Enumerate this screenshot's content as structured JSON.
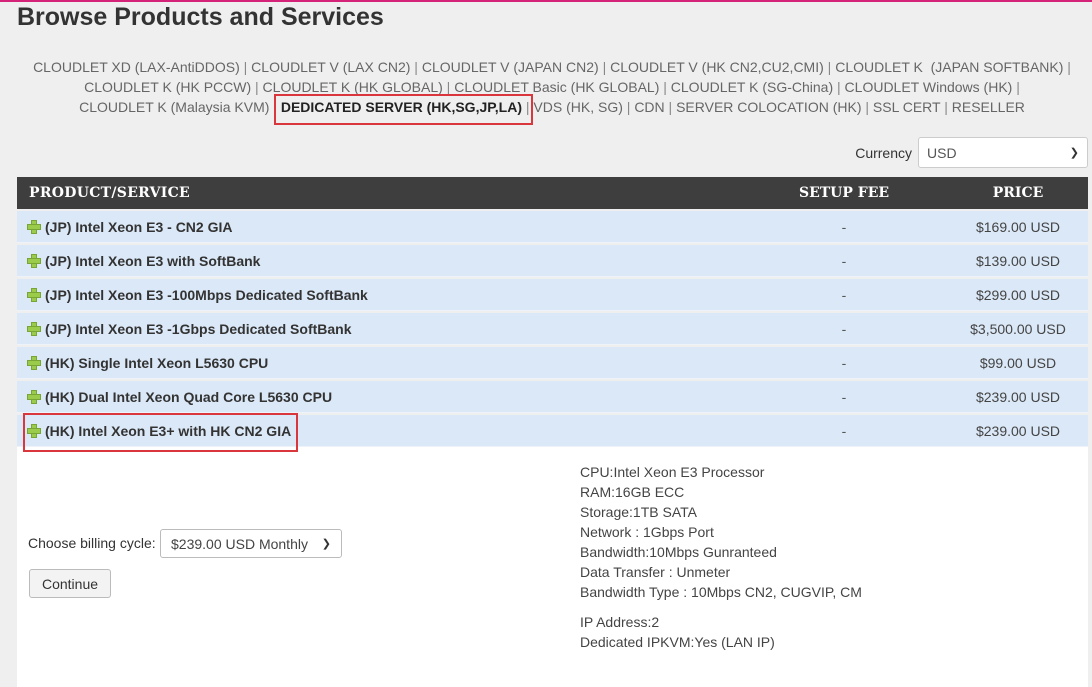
{
  "page": {
    "title": "Browse Products and Services"
  },
  "categories": [
    {
      "label": "CLOUDLET XD (LAX-AntiDDOS)",
      "active": false
    },
    {
      "label": "CLOUDLET V (LAX CN2)",
      "active": false
    },
    {
      "label": "CLOUDLET V (JAPAN CN2)",
      "active": false
    },
    {
      "label": "CLOUDLET V (HK CN2,CU2,CMI)",
      "active": false
    },
    {
      "label": "CLOUDLET K  (JAPAN SOFTBANK)",
      "active": false
    },
    {
      "label": "CLOUDLET K (HK PCCW)",
      "active": false
    },
    {
      "label": "CLOUDLET K (HK GLOBAL)",
      "active": false
    },
    {
      "label": "CLOUDLET Basic (HK GLOBAL)",
      "active": false
    },
    {
      "label": "CLOUDLET K (SG-China)",
      "active": false
    },
    {
      "label": "CLOUDLET Windows (HK)",
      "active": false
    },
    {
      "label": "CLOUDLET K (Malaysia KVM)",
      "active": false
    },
    {
      "label": "DEDICATED SERVER (HK,SG,JP,LA)",
      "active": true
    },
    {
      "label": "VDS (HK, SG)",
      "active": false
    },
    {
      "label": "CDN",
      "active": false
    },
    {
      "label": "SERVER COLOCATION (HK)",
      "active": false
    },
    {
      "label": "SSL CERT",
      "active": false
    },
    {
      "label": "RESELLER",
      "active": false
    }
  ],
  "currency": {
    "label": "Currency",
    "value": "USD"
  },
  "table": {
    "headers": {
      "product": "PRODUCT/SERVICE",
      "setup": "SETUP FEE",
      "price": "PRICE"
    },
    "rows": [
      {
        "name": "(JP) Intel Xeon E3 - CN2 GIA",
        "setup": "-",
        "price": "$169.00 USD"
      },
      {
        "name": "(JP) Intel Xeon E3 with SoftBank",
        "setup": "-",
        "price": "$139.00 USD"
      },
      {
        "name": "(JP) Intel Xeon E3 -100Mbps Dedicated SoftBank",
        "setup": "-",
        "price": "$299.00 USD"
      },
      {
        "name": "(JP) Intel Xeon E3 -1Gbps Dedicated SoftBank",
        "setup": "-",
        "price": "$3,500.00 USD"
      },
      {
        "name": "(HK) Single Intel Xeon L5630 CPU",
        "setup": "-",
        "price": "$99.00 USD"
      },
      {
        "name": "(HK) Dual Intel Xeon Quad Core L5630 CPU",
        "setup": "-",
        "price": "$239.00 USD"
      },
      {
        "name": "(HK) Intel Xeon E3+ with HK CN2 GIA",
        "setup": "-",
        "price": "$239.00 USD"
      }
    ]
  },
  "detail": {
    "billing_label": "Choose billing cycle:",
    "billing_value": "$239.00 USD Monthly",
    "continue_label": "Continue",
    "specs": [
      "CPU:Intel Xeon E3 Processor",
      "RAM:16GB ECC",
      "Storage:1TB SATA",
      "Network : 1Gbps Port",
      "Bandwidth:10Mbps Gunranteed",
      "Data Transfer : Unmeter",
      "Bandwidth Type : 10Mbps CN2, CUGVIP, CM"
    ],
    "specs2": [
      "IP Address:2",
      "Dedicated IPKVM:Yes (LAN IP)"
    ]
  },
  "colors": {
    "accent_top": "#d6237a",
    "header_bg": "#3e3e3e",
    "row_bg": "#dbe8f7",
    "highlight": "#d9363e",
    "plus_icon": "#9acb4a"
  }
}
